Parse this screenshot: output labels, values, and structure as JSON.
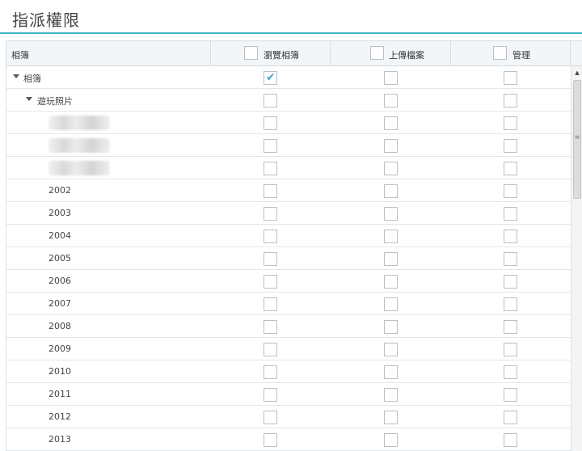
{
  "title": "指派權限",
  "header": {
    "name_col": "相簿",
    "col_browse": "瀏覽相簿",
    "col_upload": "上傳檔案",
    "col_manage": "管理"
  },
  "rows": [
    {
      "label": "相簿",
      "level": 0,
      "expanded": true,
      "browse": true,
      "upload": false,
      "manage": false
    },
    {
      "label": "遊玩照片",
      "level": 1,
      "expanded": true,
      "browse": false,
      "upload": false,
      "manage": false
    },
    {
      "label": "",
      "level": 2,
      "redacted": true,
      "browse": false,
      "upload": false,
      "manage": false
    },
    {
      "label": "",
      "level": 2,
      "redacted": true,
      "browse": false,
      "upload": false,
      "manage": false
    },
    {
      "label": "",
      "level": 2,
      "redacted": true,
      "browse": false,
      "upload": false,
      "manage": false
    },
    {
      "label": "2002",
      "level": 2,
      "browse": false,
      "upload": false,
      "manage": false
    },
    {
      "label": "2003",
      "level": 2,
      "browse": false,
      "upload": false,
      "manage": false
    },
    {
      "label": "2004",
      "level": 2,
      "browse": false,
      "upload": false,
      "manage": false
    },
    {
      "label": "2005",
      "level": 2,
      "browse": false,
      "upload": false,
      "manage": false
    },
    {
      "label": "2006",
      "level": 2,
      "browse": false,
      "upload": false,
      "manage": false
    },
    {
      "label": "2007",
      "level": 2,
      "browse": false,
      "upload": false,
      "manage": false
    },
    {
      "label": "2008",
      "level": 2,
      "browse": false,
      "upload": false,
      "manage": false
    },
    {
      "label": "2009",
      "level": 2,
      "browse": false,
      "upload": false,
      "manage": false
    },
    {
      "label": "2010",
      "level": 2,
      "browse": false,
      "upload": false,
      "manage": false
    },
    {
      "label": "2011",
      "level": 2,
      "browse": false,
      "upload": false,
      "manage": false
    },
    {
      "label": "2012",
      "level": 2,
      "browse": false,
      "upload": false,
      "manage": false
    },
    {
      "label": "2013",
      "level": 2,
      "browse": false,
      "upload": false,
      "manage": false
    }
  ],
  "colors": {
    "accent": "#3fb6c2",
    "check": "#4aa3c8",
    "header_bg": "#f3f6f9"
  }
}
